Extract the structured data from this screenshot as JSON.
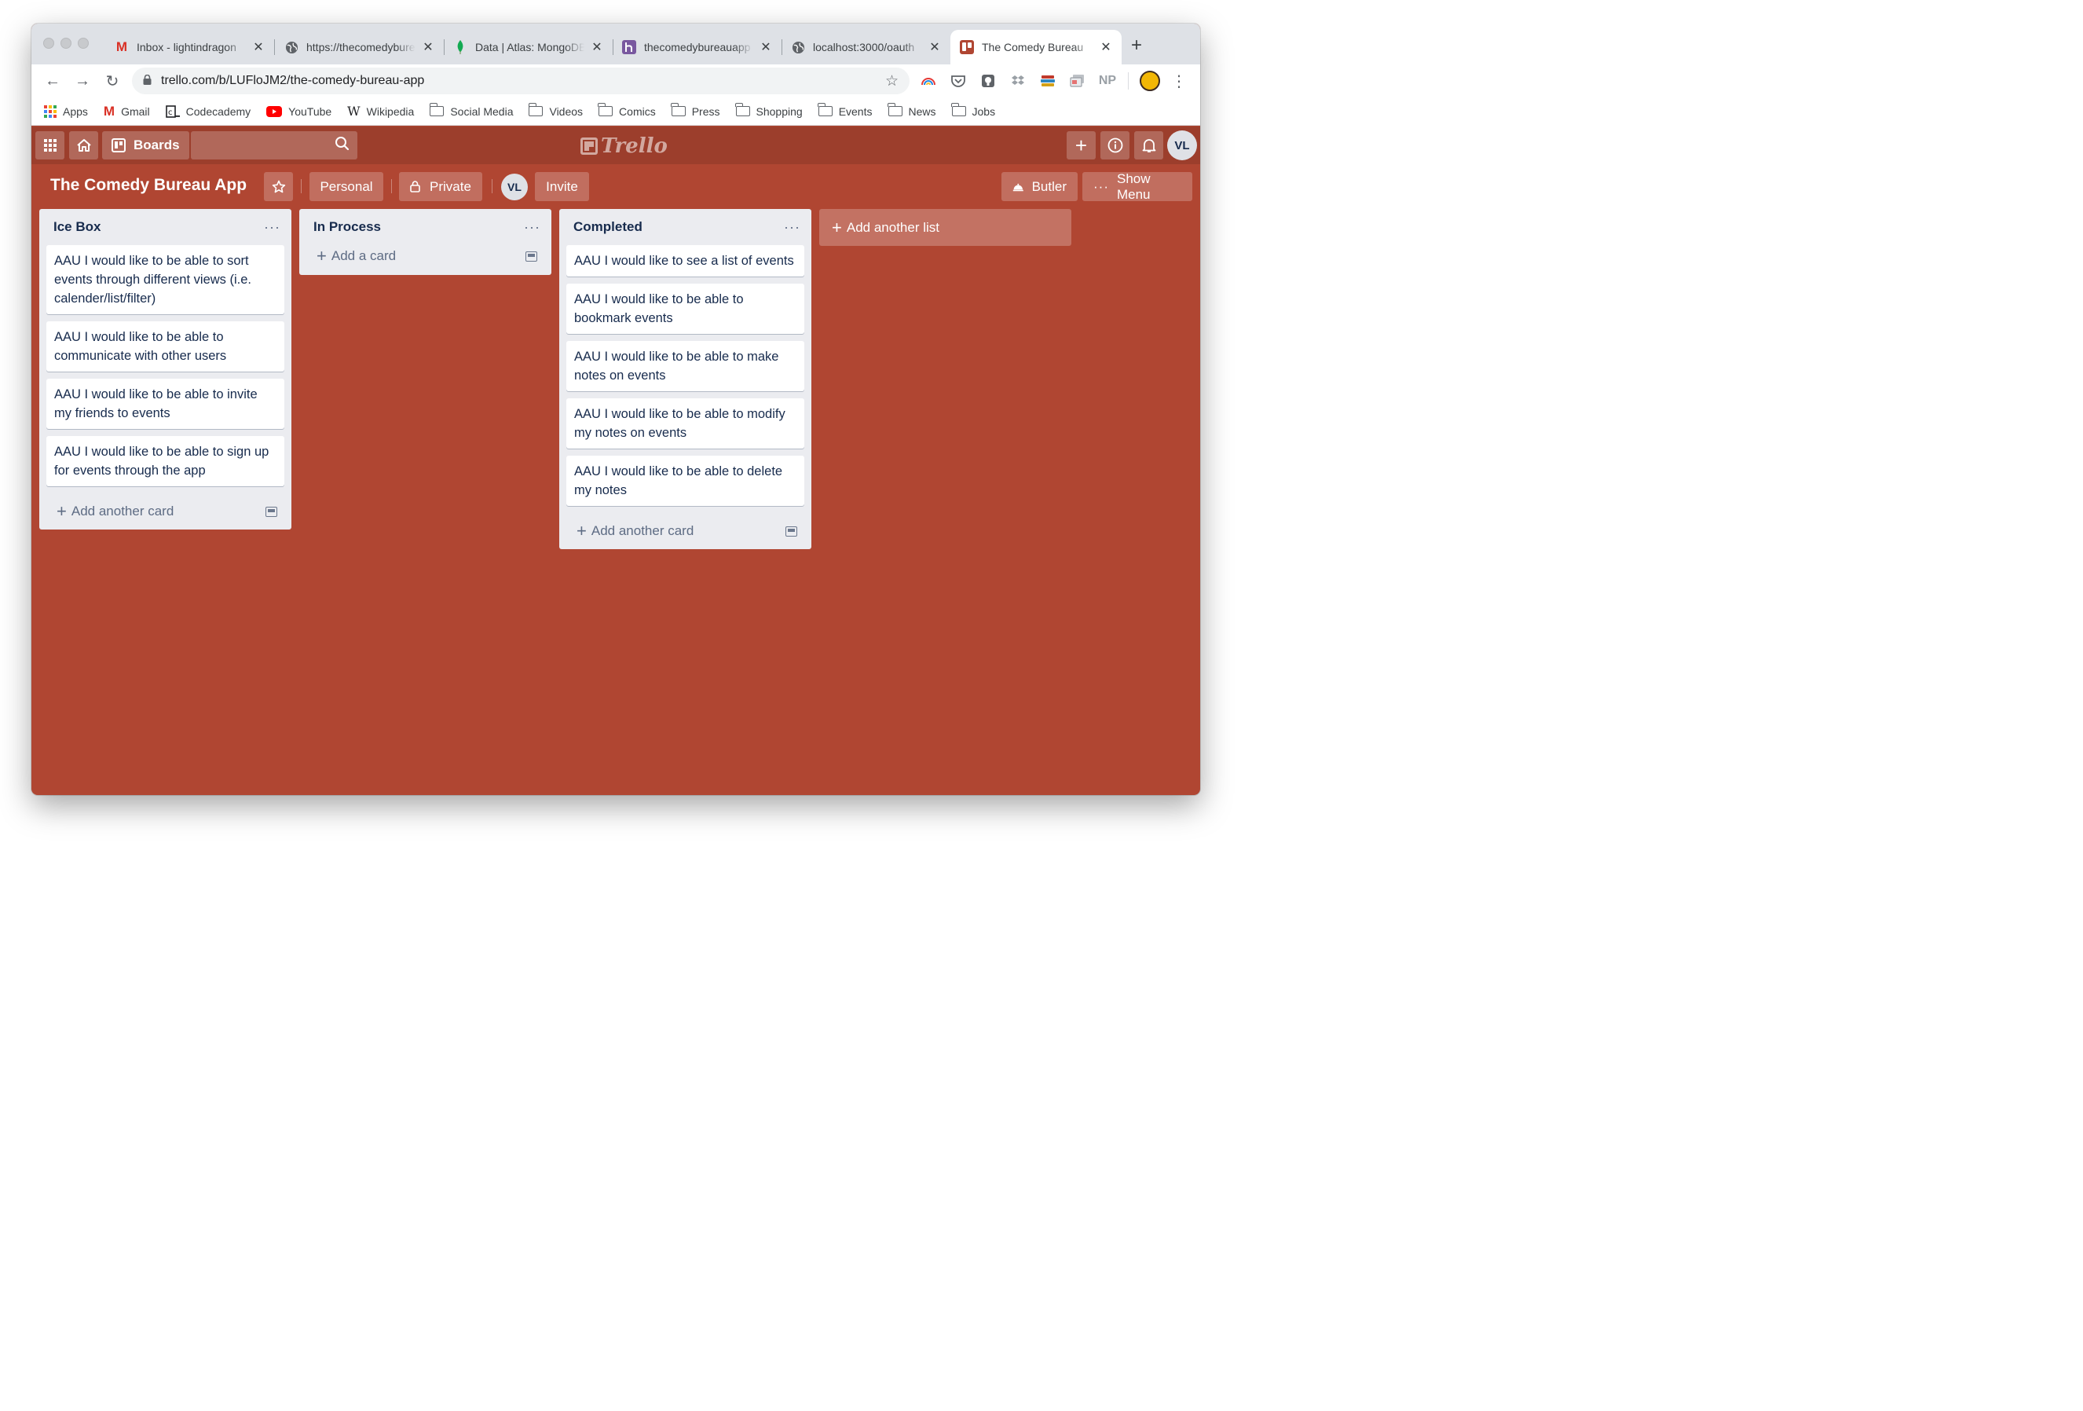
{
  "browser": {
    "tabs": [
      {
        "icon": "gmail-icon",
        "title": "Inbox - lightindragon",
        "color": "#d93025"
      },
      {
        "icon": "globe-icon",
        "title": "https://thecomedybureau",
        "color": "#5f6368"
      },
      {
        "icon": "mongodb-leaf-icon",
        "title": "Data | Atlas: MongoDB",
        "color": "#13aa52"
      },
      {
        "icon": "heroku-icon",
        "title": "thecomedybureauapp",
        "color": "#79589f"
      },
      {
        "icon": "globe-icon",
        "title": "localhost:3000/oauth",
        "color": "#5f6368"
      },
      {
        "icon": "trello-icon",
        "title": "The Comedy Bureau",
        "color": "#b04632"
      }
    ],
    "url": "trello.com/b/LUFloJM2/the-comedy-bureau-app",
    "bookmarks": [
      {
        "icon": "apps-grid-icon",
        "label": "Apps"
      },
      {
        "icon": "gmail-icon",
        "label": "Gmail"
      },
      {
        "icon": "codecademy-icon",
        "label": "Codecademy"
      },
      {
        "icon": "youtube-icon",
        "label": "YouTube"
      },
      {
        "icon": "wikipedia-icon",
        "label": "Wikipedia"
      },
      {
        "icon": "folder-icon",
        "label": "Social Media"
      },
      {
        "icon": "folder-icon",
        "label": "Videos"
      },
      {
        "icon": "folder-icon",
        "label": "Comics"
      },
      {
        "icon": "folder-icon",
        "label": "Press"
      },
      {
        "icon": "folder-icon",
        "label": "Shopping"
      },
      {
        "icon": "folder-icon",
        "label": "Events"
      },
      {
        "icon": "folder-icon",
        "label": "News"
      },
      {
        "icon": "folder-icon",
        "label": "Jobs"
      }
    ],
    "extensions": {
      "np_label": "NP"
    }
  },
  "trello": {
    "boards_label": "Boards",
    "logo_text": "Trello",
    "user_initials": "VL",
    "board": {
      "title": "The Comedy Bureau App",
      "team_label": "Personal",
      "visibility_label": "Private",
      "invite_label": "Invite",
      "butler_label": "Butler",
      "show_menu_label": "Show Menu"
    },
    "lists": [
      {
        "title": "Ice Box",
        "cards": [
          "AAU I would like to be able to sort events through different views (i.e. calender/list/filter)",
          "AAU I would like to be able to communicate with other users",
          "AAU I would like to be able to invite my friends to events",
          "AAU I would like to be able to sign up for events through the app"
        ],
        "footer": "Add another card"
      },
      {
        "title": "In Process",
        "cards": [],
        "footer": "Add a card"
      },
      {
        "title": "Completed",
        "cards": [
          "AAU I would like to see a list of events",
          "AAU I would like to be able to bookmark events",
          "AAU I would like to be able to make notes on events",
          "AAU I would like to be able to modify my notes on events",
          "AAU I would like to be able to delete my notes"
        ],
        "footer": "Add another card"
      }
    ],
    "add_list_label": "Add another list"
  },
  "colors": {
    "board_bg": "#b04632",
    "header_bg": "#9c3e2c",
    "list_bg": "#ebecf0",
    "card_text": "#172b4d"
  }
}
